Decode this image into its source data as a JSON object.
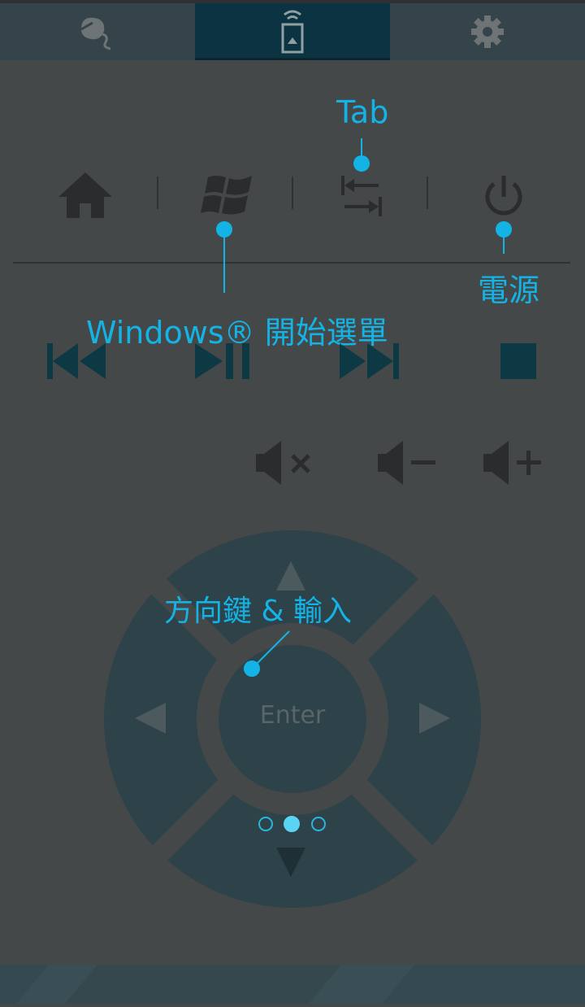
{
  "tabs": [
    {
      "icon": "mouse-icon",
      "active": false
    },
    {
      "icon": "remote-icon",
      "active": true
    },
    {
      "icon": "gear-icon",
      "active": false
    }
  ],
  "annotations": {
    "tab": "Tab",
    "power": "電源",
    "windows": "Windows® 開始選單",
    "dpad": "方向鍵 & 輸入"
  },
  "dpad": {
    "enter_label": "Enter"
  },
  "page_indicator": {
    "pages": 3,
    "current": 2
  },
  "colors": {
    "accent": "#14b3e6",
    "dpad": "#2e4249",
    "icon_dark": "#2a2c2d",
    "media": "#0c3943"
  }
}
